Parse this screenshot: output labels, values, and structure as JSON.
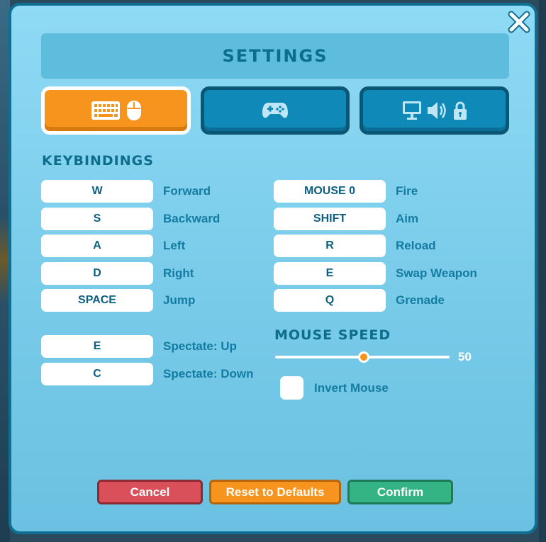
{
  "title": "SETTINGS",
  "tabs": [
    {
      "icons": [
        "keyboard-icon",
        "mouse-icon"
      ],
      "active": true
    },
    {
      "icons": [
        "gamepad-icon"
      ],
      "active": false
    },
    {
      "icons": [
        "monitor-icon",
        "speaker-icon",
        "lock-icon"
      ],
      "active": false
    }
  ],
  "keybindings": {
    "title": "KEYBINDINGS",
    "left": [
      {
        "key": "W",
        "action": "Forward"
      },
      {
        "key": "S",
        "action": "Backward"
      },
      {
        "key": "A",
        "action": "Left"
      },
      {
        "key": "D",
        "action": "Right"
      },
      {
        "key": "SPACE",
        "action": "Jump"
      }
    ],
    "spectate": [
      {
        "key": "E",
        "action": "Spectate: Up"
      },
      {
        "key": "C",
        "action": "Spectate: Down"
      }
    ],
    "right": [
      {
        "key": "MOUSE 0",
        "action": "Fire"
      },
      {
        "key": "SHIFT",
        "action": "Aim"
      },
      {
        "key": "R",
        "action": "Reload"
      },
      {
        "key": "E",
        "action": "Swap Weapon"
      },
      {
        "key": "Q",
        "action": "Grenade"
      }
    ]
  },
  "mouse_speed": {
    "title": "MOUSE SPEED",
    "value": "50",
    "level_fraction": 0.5
  },
  "invert_mouse": {
    "label": "Invert Mouse",
    "checked": false
  },
  "buttons": {
    "cancel": "Cancel",
    "reset": "Reset to Defaults",
    "confirm": "Confirm"
  },
  "colors": {
    "accent_orange": "#f7941d",
    "panel_blue": "#78cbe9",
    "title_blue": "#0d6d8c",
    "cancel_red": "#d9505b",
    "confirm_green": "#34b384"
  }
}
